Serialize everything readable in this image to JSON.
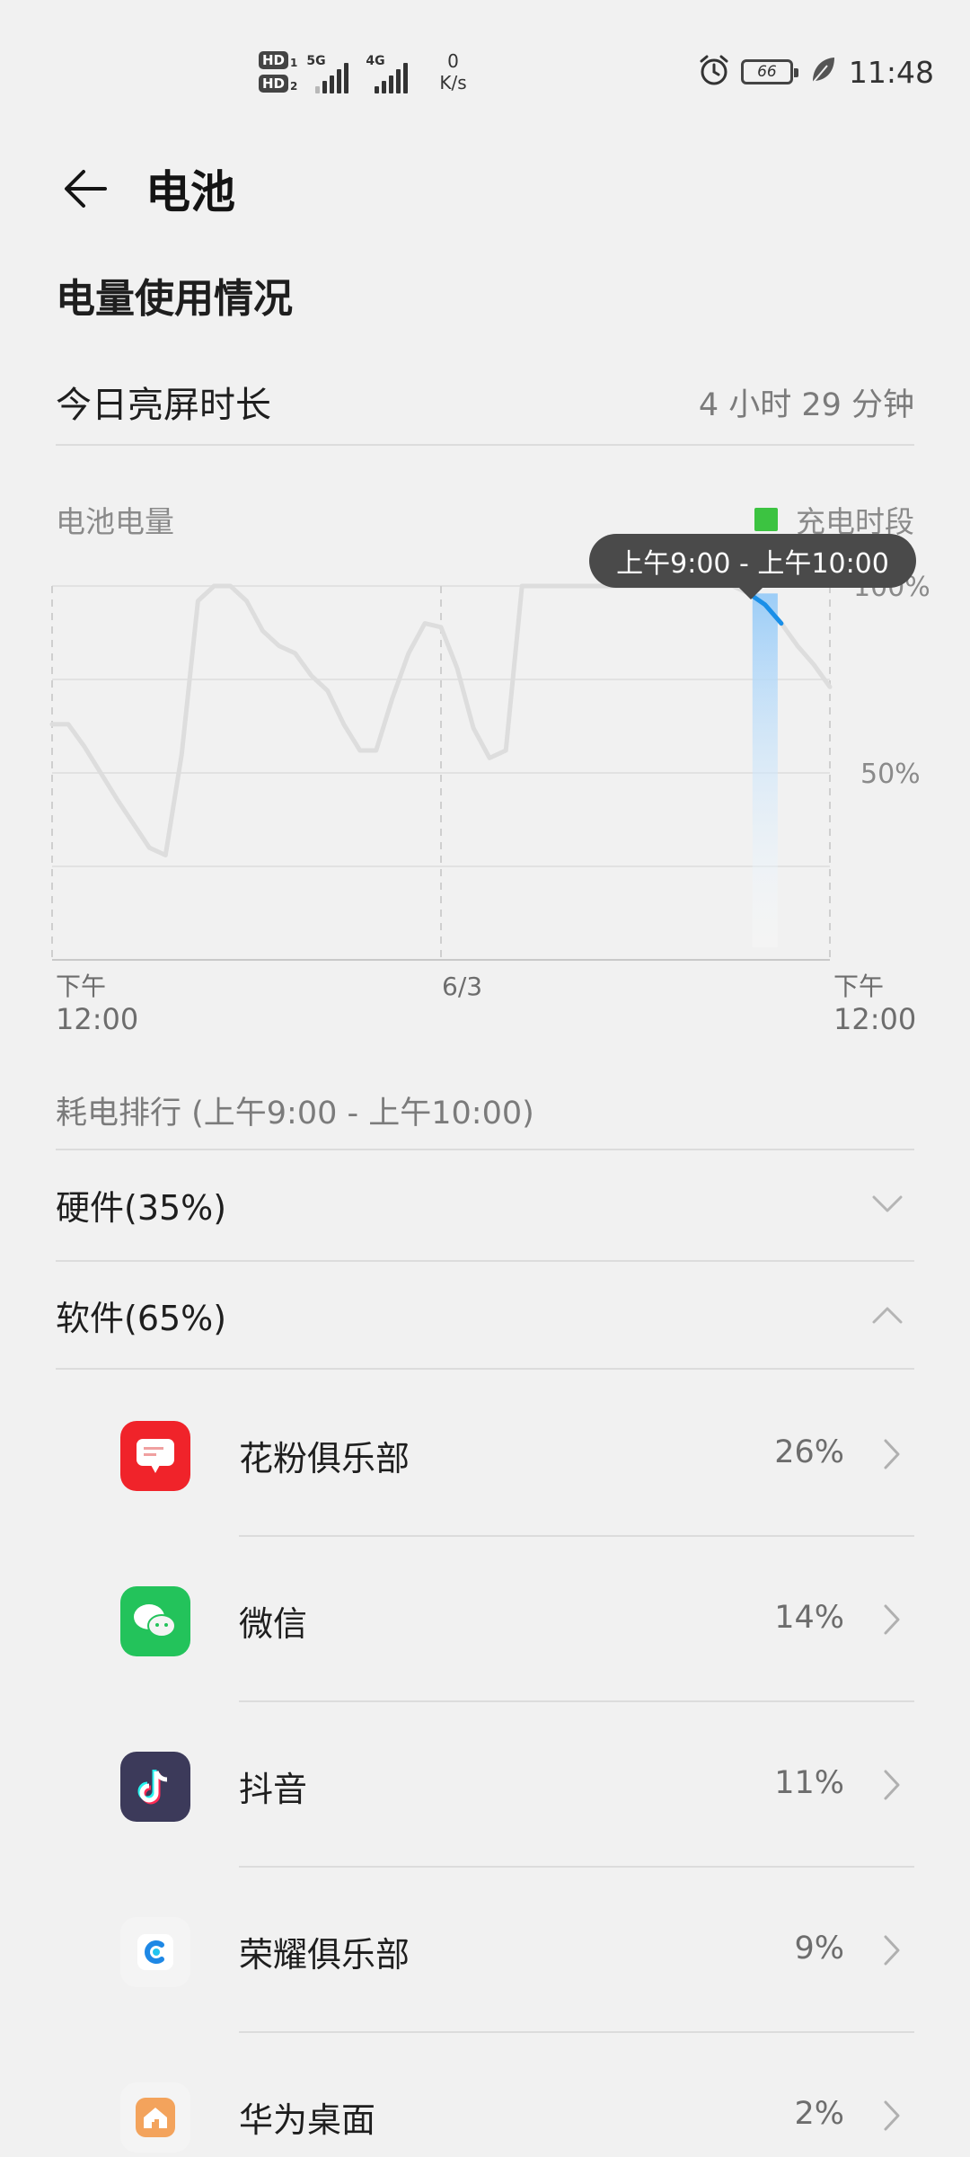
{
  "status_bar": {
    "hd1": "HD",
    "hd1_num": "1",
    "hd2": "HD",
    "hd2_num": "2",
    "sig1_label": "5G",
    "sig2_label": "4G",
    "net_speed_value": "0",
    "net_speed_unit": "K/s",
    "battery_level": "66",
    "time": "11:48",
    "icons": [
      "alarm-icon",
      "battery-icon",
      "leaf-icon"
    ]
  },
  "header": {
    "title": "电池",
    "back_icon": "arrow-left-icon"
  },
  "usage": {
    "section_title": "电量使用情况",
    "screen_time_label": "今日亮屏时长",
    "screen_time_value": "4 小时 29 分钟"
  },
  "chart_header": {
    "label": "电池电量",
    "legend_label": "充电时段",
    "legend_color": "#3cc341"
  },
  "chart_data": {
    "type": "line",
    "series": [
      {
        "values": [
          [
            0,
            63
          ],
          [
            1,
            63
          ],
          [
            2,
            57
          ],
          [
            4,
            43
          ],
          [
            6,
            30
          ],
          [
            7,
            28
          ],
          [
            8,
            55
          ],
          [
            9,
            96
          ],
          [
            10,
            100
          ],
          [
            11,
            100
          ],
          [
            12,
            96
          ],
          [
            13,
            88
          ],
          [
            14,
            84
          ],
          [
            15,
            82
          ],
          [
            16,
            76
          ],
          [
            17,
            72
          ],
          [
            18,
            63
          ],
          [
            19,
            56
          ],
          [
            20,
            56
          ],
          [
            21,
            70
          ],
          [
            22,
            82
          ],
          [
            23,
            90
          ],
          [
            24,
            89
          ],
          [
            25,
            78
          ],
          [
            26,
            62
          ],
          [
            27,
            54
          ],
          [
            28,
            56
          ],
          [
            29,
            100
          ],
          [
            30,
            100
          ],
          [
            34,
            100
          ],
          [
            38,
            100
          ],
          [
            42,
            100
          ],
          [
            43,
            98
          ],
          [
            44,
            95
          ],
          [
            45,
            90
          ],
          [
            46,
            84
          ],
          [
            47,
            79
          ],
          [
            48,
            73
          ]
        ]
      }
    ],
    "selected_segment": {
      "x_from": 43,
      "x_to": 45,
      "tooltip": "上午9:00 - 上午10:00"
    },
    "y_ticks": [
      "100%",
      "50%"
    ],
    "ylim": [
      0,
      100
    ],
    "x_ticks": [
      {
        "line1": "下午",
        "line2": "12:00"
      },
      {
        "line1": "6/3",
        "line2": ""
      },
      {
        "line1": "下午",
        "line2": "12:00"
      }
    ],
    "line_color": "#dddddd",
    "highlight_color": "#1a8fe8",
    "grid": true
  },
  "ranking": {
    "title": "耗电排行 (上午9:00 - 上午10:00)",
    "hardware_label": "硬件(35%)",
    "software_label": "软件(65%)",
    "apps": [
      {
        "name": "花粉俱乐部",
        "percent": "26%",
        "icon": "huafen-club-icon",
        "color": "#f0232a"
      },
      {
        "name": "微信",
        "percent": "14%",
        "icon": "wechat-icon",
        "color": "#23c35b"
      },
      {
        "name": "抖音",
        "percent": "11%",
        "icon": "douyin-icon",
        "color": "#3c3a5a"
      },
      {
        "name": "荣耀俱乐部",
        "percent": "9%",
        "icon": "honor-club-icon",
        "color": "#f4f4f4"
      },
      {
        "name": "华为桌面",
        "percent": "2%",
        "icon": "huawei-home-icon",
        "color": "#f3a35c"
      }
    ]
  }
}
